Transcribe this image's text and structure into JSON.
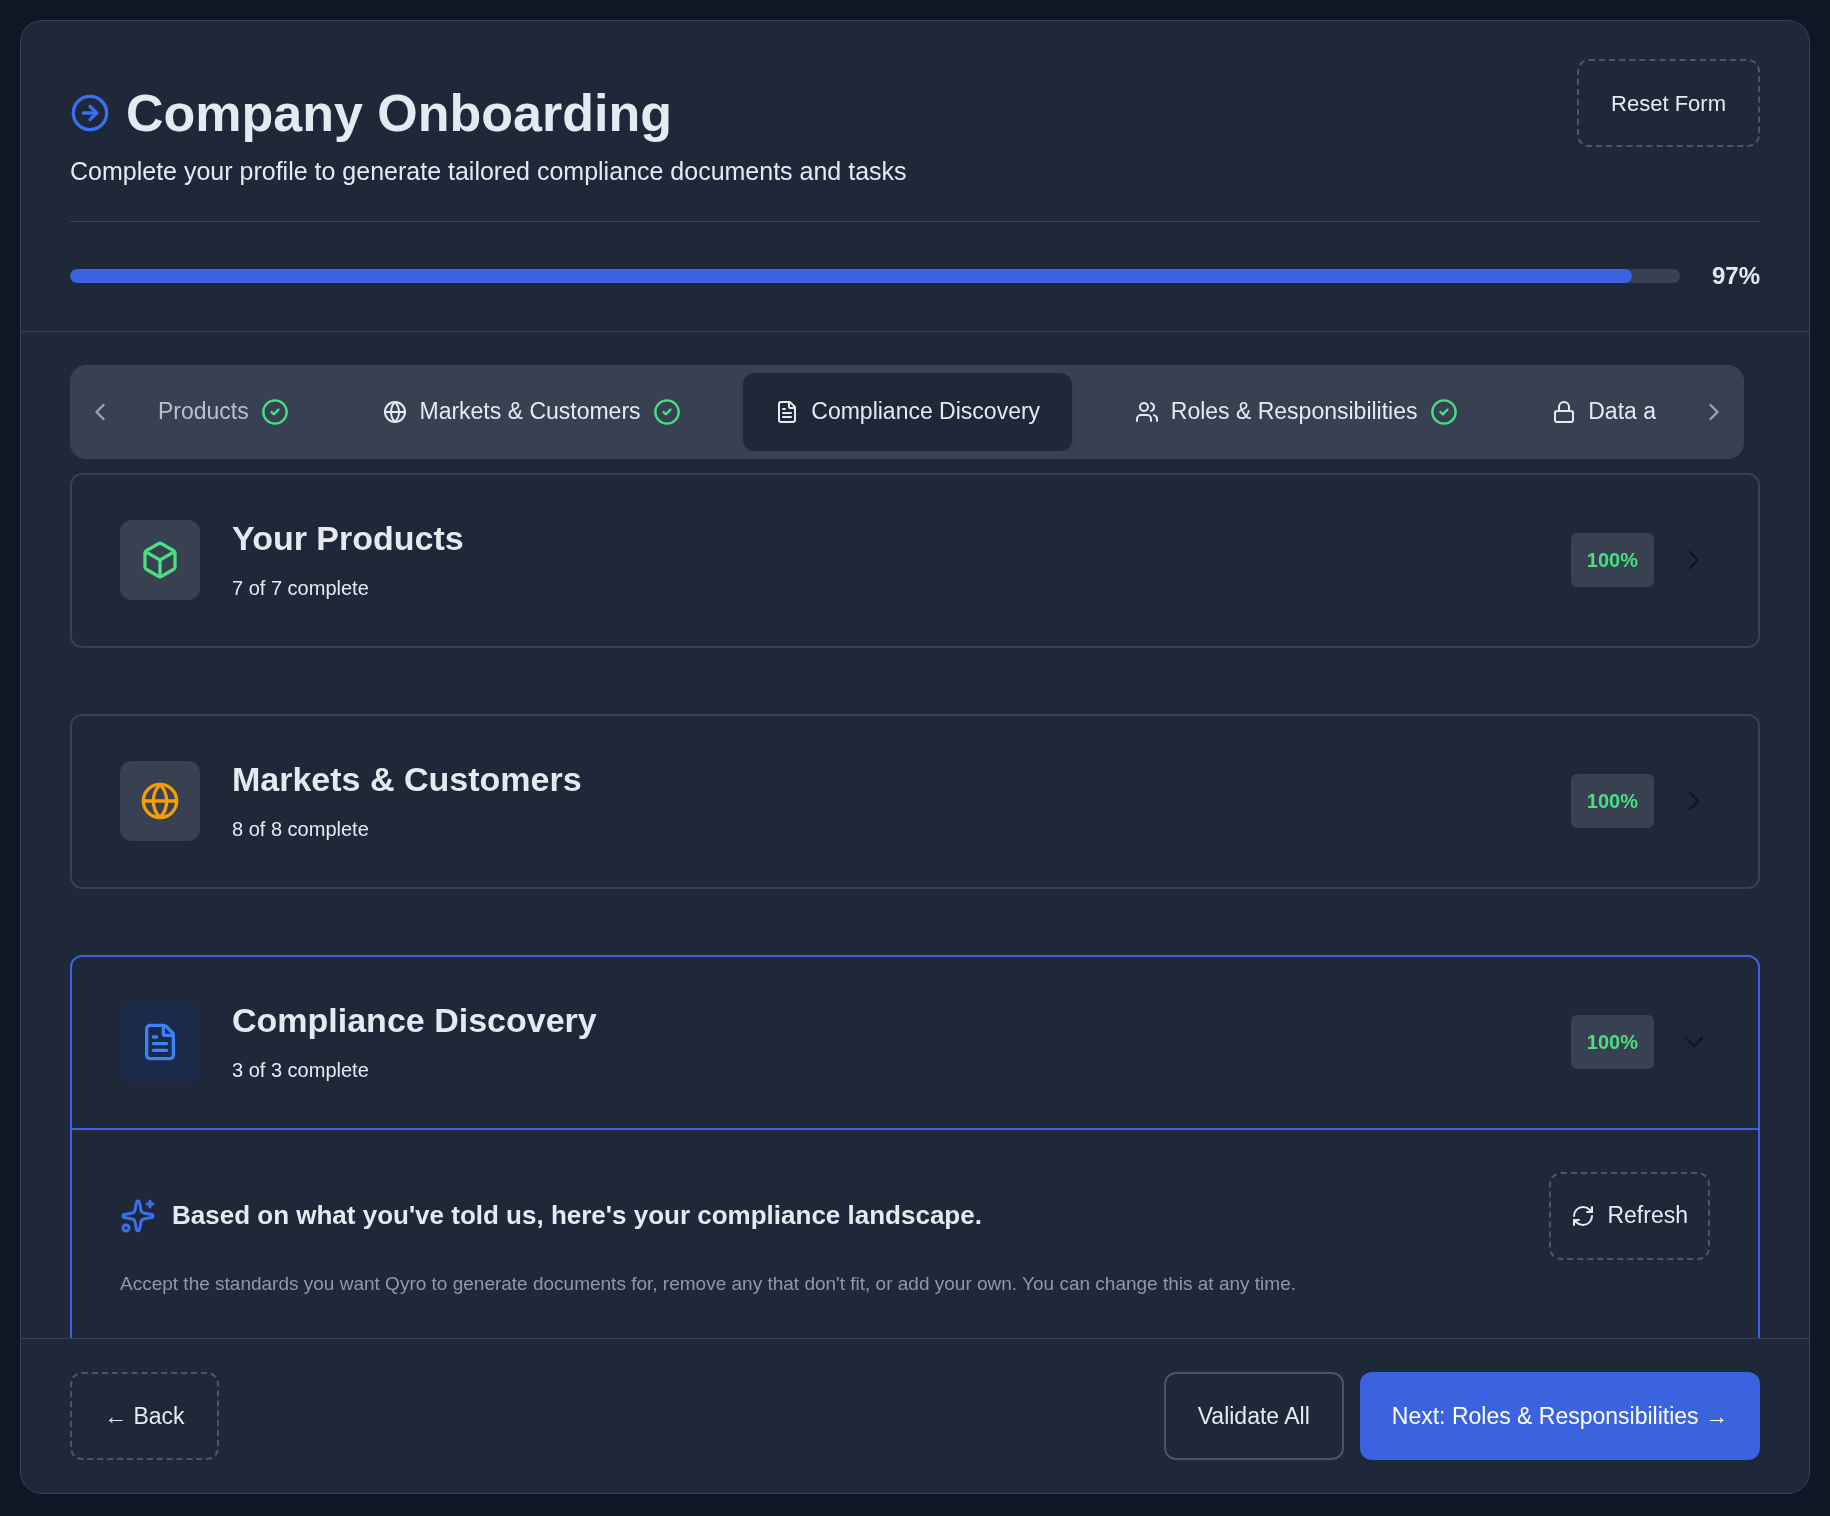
{
  "header": {
    "title": "Company Onboarding",
    "subtitle": "Complete your profile to generate tailored compliance documents and tasks",
    "reset_button": "Reset Form",
    "progress": {
      "level": 0.97,
      "reading": "97%"
    }
  },
  "tabs": [
    {
      "label": "Products",
      "selected": false,
      "completed": true,
      "kind": "cut"
    },
    {
      "label": "Markets & Customers",
      "selected": false,
      "completed": true,
      "kind": "globe"
    },
    {
      "label": "Compliance Discovery",
      "selected": true,
      "completed": false,
      "kind": "file"
    },
    {
      "label": "Roles & Responsibilities",
      "selected": false,
      "completed": true,
      "kind": "users"
    },
    {
      "label": "Data a",
      "selected": false,
      "completed": false,
      "kind": "lock"
    }
  ],
  "sections": [
    {
      "title": "Your Products",
      "subtitle": "7 of 7 complete",
      "percent": "100%",
      "expanded": false,
      "kind": "box",
      "color": "#4ade80"
    },
    {
      "title": "Markets & Customers",
      "subtitle": "8 of 8 complete",
      "percent": "100%",
      "expanded": false,
      "kind": "globe",
      "color": "#f59e0b"
    },
    {
      "title": "Compliance Discovery",
      "subtitle": "3 of 3 complete",
      "percent": "100%",
      "expanded": true,
      "kind": "file",
      "color": "#3b82f6"
    }
  ],
  "discovery": {
    "heading": "Based on what you've told us, here's your compliance landscape.",
    "refresh_button": "Refresh",
    "description": "Accept the standards you want Qyro to generate documents for, remove any that don't fit, or add your own. You can change this at any time."
  },
  "footer": {
    "back_button": "← Back",
    "validate_button": "Validate All",
    "next_button": "Next: Roles & Responsibilities →"
  }
}
